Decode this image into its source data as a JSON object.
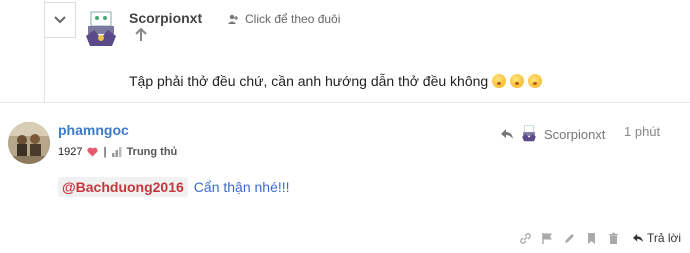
{
  "quoted": {
    "username": "Scorpionxt",
    "follow_label": "Click để theo đuôi",
    "text": "Tập phải thở đều chứ, cần anh hướng dẫn thở đều không",
    "emojis": [
      "shushing-face-emoji",
      "shushing-face-emoji",
      "shushing-face-emoji"
    ]
  },
  "post": {
    "username": "phamngoc",
    "likes": "1927",
    "rank": "Trung thủ",
    "reply_to_user": "Scorpionxt",
    "time": "1 phút",
    "mention": "@Bachduong2016",
    "text": "Cẩn thận nhé!!!",
    "reply_label": "Trả lời"
  },
  "colors": {
    "username_blue": "#3a7cc8",
    "mention_red": "#c5373b",
    "heart": "#e45a6e"
  }
}
